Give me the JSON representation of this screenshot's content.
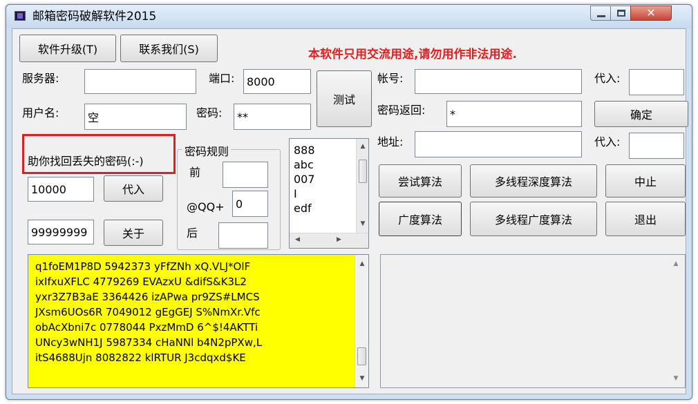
{
  "window": {
    "title": "邮箱密码破解软件2015",
    "close_glyph": "✕"
  },
  "toolbar": {
    "upgrade": "软件升级(T)",
    "contact": "联系我们(S)"
  },
  "warning": "本软件只用交流用途,请勿用作非法用途.",
  "server": {
    "label": "服务器:",
    "value": ""
  },
  "port": {
    "label": "端口:",
    "value": "8000"
  },
  "test_button": "测试",
  "username": {
    "label": "用户名:",
    "value": "空"
  },
  "password": {
    "label": "密码:",
    "value": "**"
  },
  "helper_text": "助你找回丢失的密码(:-)",
  "range": {
    "start": "10000",
    "end": "99999999"
  },
  "substitute_button": "代入",
  "about_button": "关于",
  "rules": {
    "title": "密码规则",
    "prefix_label": "前",
    "qq_label": "@QQ+",
    "qq_value": "0",
    "suffix_label": "后",
    "prefix_value": "",
    "suffix_value": ""
  },
  "wordlist": [
    "888",
    "abc",
    "007",
    "I",
    "edf"
  ],
  "account": {
    "label": "帐号:",
    "value": ""
  },
  "substitute_label_1": "代入:",
  "password_return": {
    "label": "密码返回:",
    "value": "*"
  },
  "confirm_button": "确定",
  "address": {
    "label": "地址:",
    "value": ""
  },
  "substitute_label_2": "代入:",
  "algorithms": {
    "try": "尝试算法",
    "multi_depth": "多线程深度算法",
    "stop": "中止",
    "breadth": "广度算法",
    "multi_breadth": "多线程广度算法",
    "exit": "退出"
  },
  "output_lines": [
    "q1foEM1P8D  5942373  yFfZNh  xQ.VLJ*OlF",
    "ixIfxuXFLC  4779269  EVAzxU  &difS&K3L2",
    "yxr3Z7B3aE  3364426  izAPwa  pr9ZS#LMCS",
    "JXsm6UOs6R  7049012  gEgGEJ  S%NmXr.Vfc",
    "obAcXbni7c  0778044  PxzMmD  6^$!4AKTTi",
    "UNcy3wNH1J  5987334  cHaNNl  b4N2pPXw,L",
    "itS4688Ujn  8082822  klRTUR  J3cdqxd$KE"
  ],
  "colors": {
    "warning": "#e02020",
    "output_bg": "#ffff00",
    "highlight": "#e02020",
    "window_frame": "#cfdff2"
  }
}
